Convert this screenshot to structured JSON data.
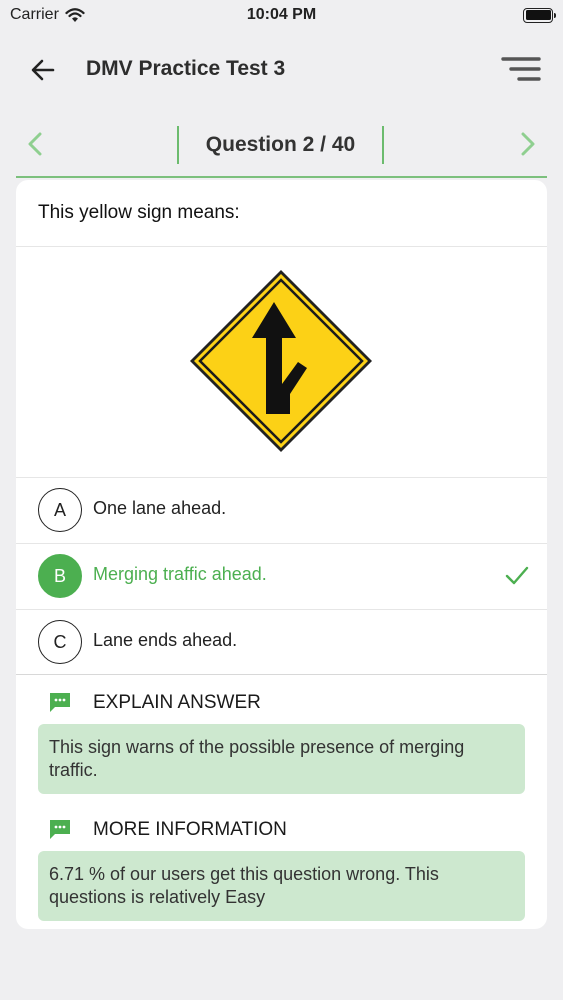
{
  "status_bar": {
    "carrier": "Carrier",
    "time": "10:04 PM"
  },
  "header": {
    "title": "DMV Practice Test 3"
  },
  "question_nav": {
    "label": "Question 2 / 40"
  },
  "question": {
    "text": "This yellow sign means:"
  },
  "options": [
    {
      "letter": "A",
      "text": "One lane ahead.",
      "state": "default"
    },
    {
      "letter": "B",
      "text": "Merging traffic ahead.",
      "state": "correct"
    },
    {
      "letter": "C",
      "text": "Lane ends ahead.",
      "state": "default"
    }
  ],
  "explain": {
    "title": "EXPLAIN ANSWER",
    "text": "This sign warns of the possible presence of merging traffic."
  },
  "more_info": {
    "title": "MORE INFORMATION",
    "text": "6.71 % of our users get this question wrong. This questions is relatively Easy"
  },
  "colors": {
    "accent": "#4caf50",
    "info_bg": "#cde8cf",
    "sign_yellow": "#fcd116"
  }
}
